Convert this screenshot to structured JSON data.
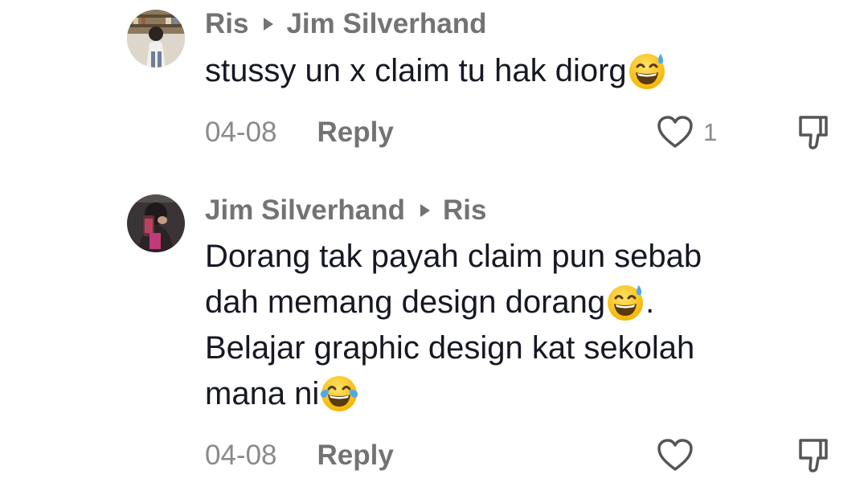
{
  "comments": [
    {
      "author": "Ris",
      "reply_to": "Jim Silverhand",
      "text": "stussy un x claim tu hak diorg",
      "emoji_icon": "grinning-face-with-sweat-icon",
      "date": "04-08",
      "reply_label": "Reply",
      "like_count": "1"
    },
    {
      "author": "Jim Silverhand",
      "reply_to": "Ris",
      "text_line1": "Dorang tak payah claim pun sebab",
      "text_line2": "dah memang design dorang",
      "text_line2_suffix": ".",
      "text_line3": "Belajar graphic design kat sekolah",
      "text_line4": "mana ni",
      "emoji_icons": [
        "grinning-face-with-sweat-icon",
        "face-with-tears-of-joy-icon"
      ],
      "date": "04-08",
      "reply_label": "Reply"
    }
  ],
  "colors": {
    "text_primary": "#161823",
    "text_secondary": "#737373",
    "meta": "#8a8a8a",
    "emoji_face": "#FFCC33",
    "emoji_sweat": "#4FA8E8"
  }
}
